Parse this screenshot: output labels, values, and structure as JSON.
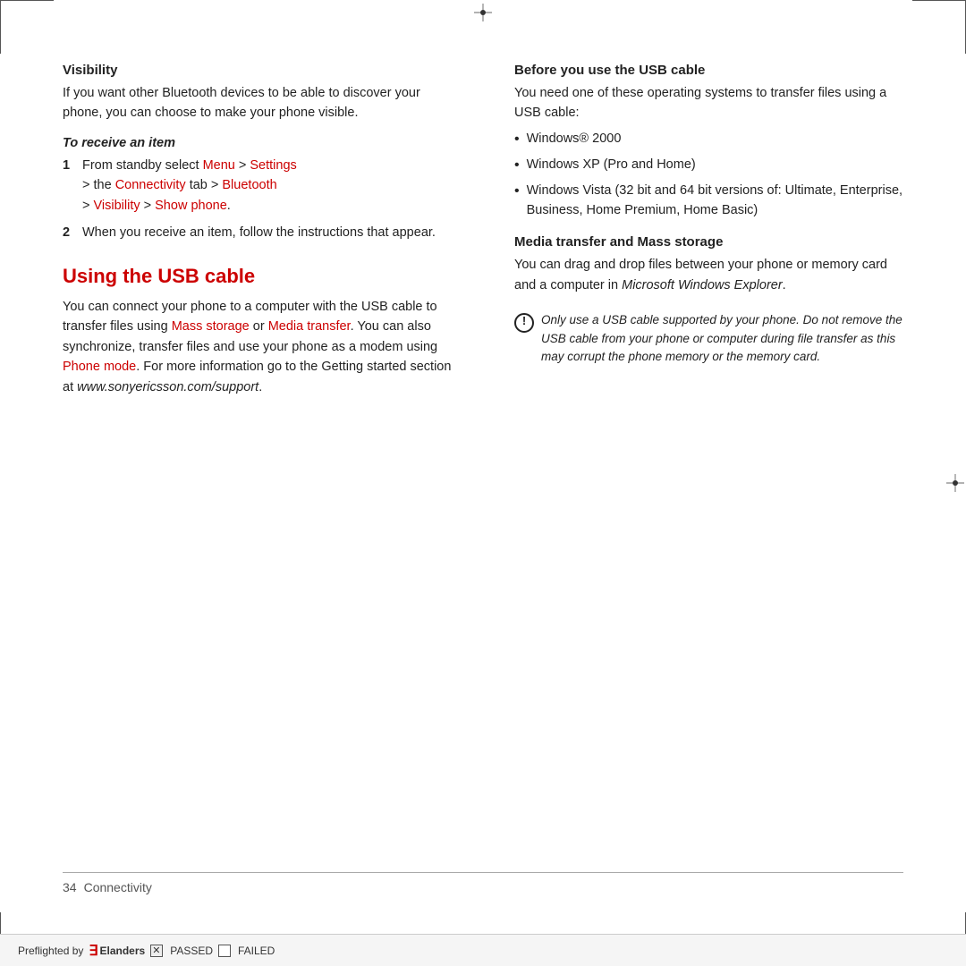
{
  "page": {
    "number": "34",
    "section": "Connectivity"
  },
  "preflight": {
    "label": "Preflighted by",
    "brand": "Elanders",
    "passed_label": "PASSED",
    "failed_label": "FAILED"
  },
  "left_column": {
    "visibility_heading": "Visibility",
    "visibility_body": "If you want other Bluetooth devices to be able to discover your phone, you can choose to make your phone visible.",
    "receive_item_heading": "To receive an item",
    "steps": [
      {
        "num": "1",
        "text_parts": [
          {
            "text": "From standby select ",
            "red": false
          },
          {
            "text": "Menu",
            "red": true
          },
          {
            "text": " > ",
            "red": false
          },
          {
            "text": "Settings",
            "red": true
          },
          {
            "text": " > the ",
            "red": false
          },
          {
            "text": "Connectivity",
            "red": true
          },
          {
            "text": " tab > ",
            "red": false
          },
          {
            "text": "Bluetooth",
            "red": true
          },
          {
            "text": " > ",
            "red": false
          },
          {
            "text": "Visibility",
            "red": true
          },
          {
            "text": " > ",
            "red": false
          },
          {
            "text": "Show phone",
            "red": true
          },
          {
            "text": ".",
            "red": false
          }
        ]
      },
      {
        "num": "2",
        "text": "When you receive an item, follow the instructions that appear."
      }
    ],
    "usb_title": "Using the USB cable",
    "usb_body_parts": [
      {
        "text": "You can connect your phone to a computer with the USB cable to transfer files using ",
        "red": false
      },
      {
        "text": "Mass storage",
        "red": true
      },
      {
        "text": " or ",
        "red": false
      },
      {
        "text": "Media transfer",
        "red": true
      },
      {
        "text": ". You can also synchronize, transfer files and use your phone as a modem using ",
        "red": false
      },
      {
        "text": "Phone mode",
        "red": true
      },
      {
        "text": ". For more information go to the Getting started section at ",
        "red": false
      },
      {
        "text": "www.sonyericsson.com/support",
        "red": false,
        "italic": true
      },
      {
        "text": ".",
        "red": false
      }
    ]
  },
  "right_column": {
    "before_usb_heading": "Before you use the USB cable",
    "before_usb_body": "You need one of these operating systems to transfer files using a USB cable:",
    "os_list": [
      "Windows® 2000",
      "Windows XP (Pro and Home)",
      "Windows Vista (32 bit and 64 bit versions of: Ultimate, Enterprise, Business, Home Premium, Home Basic)"
    ],
    "media_transfer_heading": "Media transfer and Mass storage",
    "media_transfer_body_parts": [
      {
        "text": "You can drag and drop files between your phone or memory card and a computer in ",
        "red": false
      },
      {
        "text": "Microsoft Windows Explorer",
        "red": false,
        "italic": true
      },
      {
        "text": ".",
        "red": false
      }
    ],
    "warning_text": "Only use a USB cable supported by your phone. Do not remove the USB cable from your phone or computer during file transfer as this may corrupt the phone memory or the memory card."
  }
}
